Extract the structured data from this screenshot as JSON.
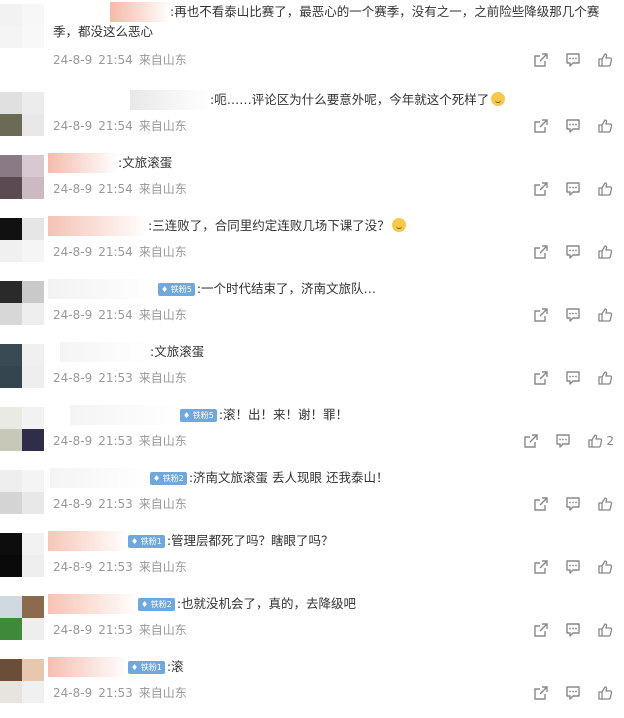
{
  "comments": [
    {
      "text": "再也不看泰山比赛了，最恶心的一个赛季，没有之一，之前险些降级那几个赛季，都没这么恶心",
      "badge": "",
      "emoji": false,
      "date": "24-8-9",
      "time": "21:54",
      "source": "来自山东",
      "likes": ""
    },
    {
      "text": "呃……评论区为什么要意外呢，今年就这个死样了",
      "badge": "",
      "emoji": true,
      "date": "24-8-9",
      "time": "21:54",
      "source": "来自山东",
      "likes": ""
    },
    {
      "text": "文旅滚蛋",
      "badge": "",
      "emoji": false,
      "date": "24-8-9",
      "time": "21:54",
      "source": "来自山东",
      "likes": ""
    },
    {
      "text": "三连败了，合同里约定连败几场下课了没？",
      "badge": "",
      "emoji": true,
      "date": "24-8-9",
      "time": "21:54",
      "source": "来自山东",
      "likes": ""
    },
    {
      "text": "一个时代结束了，济南文旅队…",
      "badge": "铁粉5",
      "emoji": false,
      "date": "24-8-9",
      "time": "21:54",
      "source": "来自山东",
      "likes": ""
    },
    {
      "text": "文旅滚蛋",
      "badge": "",
      "emoji": false,
      "date": "24-8-9",
      "time": "21:53",
      "source": "来自山东",
      "likes": ""
    },
    {
      "text": "滚！出！来！谢！罪！",
      "badge": "铁粉5",
      "emoji": false,
      "date": "24-8-9",
      "time": "21:53",
      "source": "来自山东",
      "likes": "2"
    },
    {
      "text": "济南文旅滚蛋  丢人现眼 还我泰山！",
      "badge": "铁粉2",
      "emoji": false,
      "date": "24-8-9",
      "time": "21:53",
      "source": "来自山东",
      "likes": ""
    },
    {
      "text": "管理层都死了吗？瞎眼了吗？",
      "badge": "铁粉1",
      "emoji": false,
      "date": "24-8-9",
      "time": "21:53",
      "source": "来自山东",
      "likes": ""
    },
    {
      "text": "也就没机会了，真的，去降级吧",
      "badge": "铁粉2",
      "emoji": false,
      "date": "24-8-9",
      "time": "21:53",
      "source": "来自山东",
      "likes": ""
    },
    {
      "text": "滚",
      "badge": "铁粉1",
      "emoji": false,
      "date": "24-8-9",
      "time": "21:53",
      "source": "来自山东",
      "likes": ""
    }
  ],
  "icons": {
    "share": "share-icon",
    "comment": "comment-icon",
    "like": "thumbs-up-icon"
  },
  "colors": {
    "meta": "#999999",
    "badge": "#6fa8dc",
    "text": "#333333"
  }
}
